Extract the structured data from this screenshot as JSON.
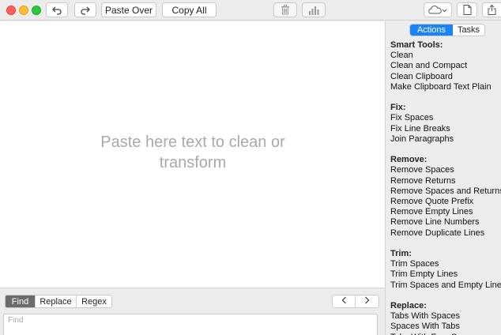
{
  "toolbar": {
    "paste_over": "Paste Over",
    "copy_all": "Copy All"
  },
  "editor": {
    "placeholder": "Paste here text to clean or transform"
  },
  "find": {
    "tabs": [
      "Find",
      "Replace",
      "Regex"
    ],
    "active_tab": "Find",
    "placeholder": "Find"
  },
  "panel": {
    "tabs": [
      "Actions",
      "Tasks"
    ],
    "active_tab": "Actions",
    "sections": [
      {
        "title": "Smart Tools:",
        "items": [
          "Clean",
          "Clean and Compact",
          "Clean Clipboard",
          "Make Clipboard Text Plain"
        ]
      },
      {
        "title": "Fix:",
        "items": [
          "Fix Spaces",
          "Fix Line Breaks",
          "Join Paragraphs"
        ]
      },
      {
        "title": "Remove:",
        "items": [
          "Remove Spaces",
          "Remove Returns",
          "Remove Spaces and Returns",
          "Remove Quote Prefix",
          "Remove Empty Lines",
          "Remove Line Numbers",
          "Remove Duplicate Lines"
        ]
      },
      {
        "title": "Trim:",
        "items": [
          "Trim Spaces",
          "Trim Empty Lines",
          "Trim Spaces and Empty Lines"
        ]
      },
      {
        "title": "Replace:",
        "items": [
          "Tabs With Spaces",
          "Spaces With Tabs",
          "Tabs With Four Spaces"
        ]
      }
    ]
  },
  "colors": {
    "accent": "#1a82fb",
    "close": "#fe5f57",
    "minimize": "#febc2e",
    "zoom": "#28c840"
  },
  "icons": [
    "undo-icon",
    "redo-icon",
    "trash-icon",
    "stats-icon",
    "cloud-icon",
    "document-icon",
    "share-icon",
    "chevron-left-icon",
    "chevron-right-icon"
  ]
}
